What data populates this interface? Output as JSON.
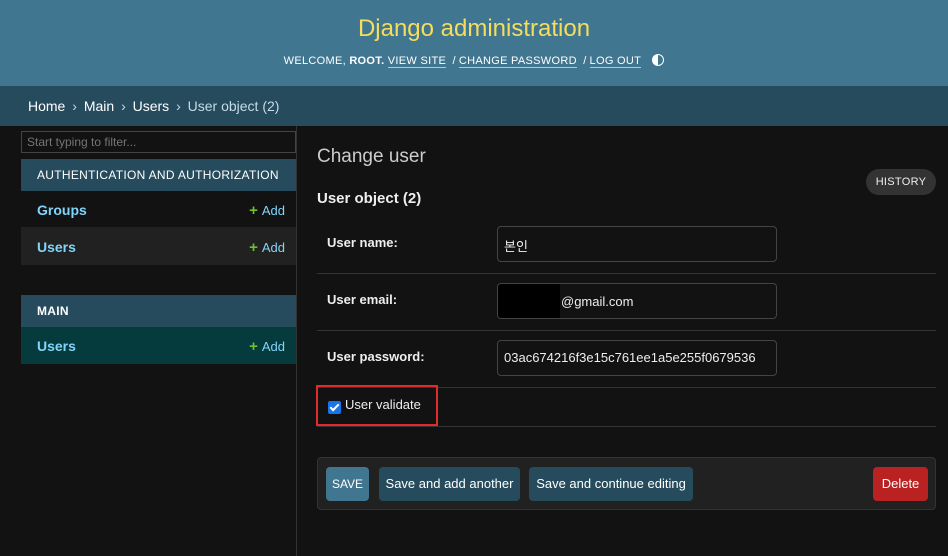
{
  "header": {
    "site_name": "Django administration",
    "welcome_prefix": "WELCOME,",
    "username": "ROOT.",
    "view_site": "VIEW SITE",
    "separator": "/",
    "change_password": "CHANGE PASSWORD",
    "log_out": "LOG OUT",
    "theme_icon": "half-circle-contrast-icon"
  },
  "breadcrumbs": {
    "items": [
      "Home",
      "Main",
      "Users"
    ],
    "arrow": "›",
    "current": "User object (2)"
  },
  "sidebar": {
    "filter_placeholder": "Start typing to filter...",
    "modules": [
      {
        "caption": "AUTHENTICATION AND AUTHORIZATION",
        "rows": [
          {
            "model": "Groups",
            "add_label": "Add"
          },
          {
            "model": "Users",
            "add_label": "Add"
          }
        ]
      },
      {
        "caption": "MAIN",
        "rows": [
          {
            "model": "Users",
            "add_label": "Add",
            "selected": true
          }
        ]
      }
    ],
    "add_symbol": "+"
  },
  "main": {
    "title": "Change user",
    "history_label": "HISTORY",
    "object_title": "User object (2)",
    "fields": [
      {
        "label": "User name:",
        "value": "본인"
      },
      {
        "label": "User email:",
        "value": "@gmail.com",
        "redacted_prefix": true
      },
      {
        "label": "User password:",
        "value": "03ac674216f3e15c761ee1a5e255f0679536"
      }
    ],
    "checkbox": {
      "label": "User validate",
      "checked": true
    },
    "buttons": {
      "save": "SAVE",
      "save_add_another": "Save and add another",
      "save_continue": "Save and continue editing",
      "delete": "Delete"
    }
  },
  "colors": {
    "header_bg": "#417690",
    "site_title": "#f5dd5d",
    "breadcrumb_bg": "#264b5d",
    "link": "#81d4fa",
    "add_plus": "#70bf2b",
    "delete": "#ba2121",
    "highlight": "#e02b2b"
  }
}
